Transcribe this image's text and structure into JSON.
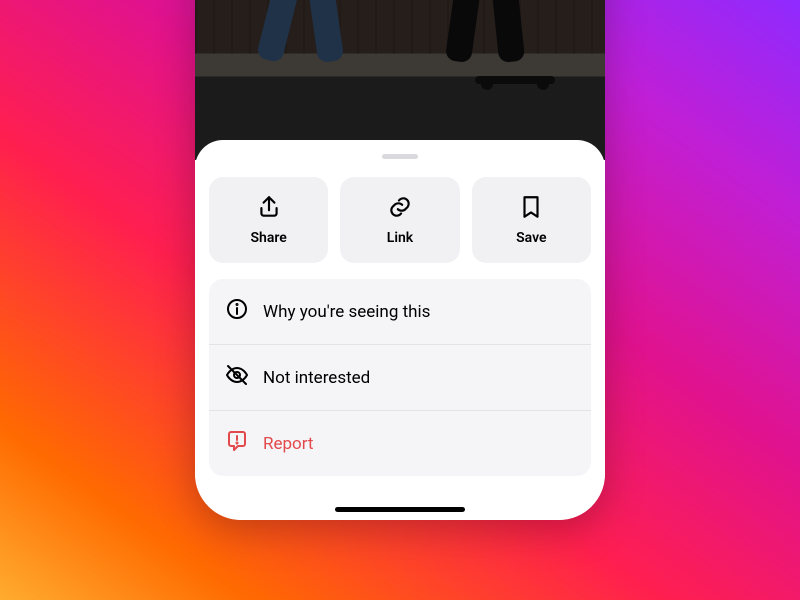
{
  "colors": {
    "sheet_bg": "#ffffff",
    "tile_bg": "#f1f1f3",
    "list_bg": "#f5f5f7",
    "divider": "#e3e3e6",
    "danger": "#e2494c",
    "gradient": [
      "#ffac2e",
      "#ff6a00",
      "#ff1f4f",
      "#e1128d",
      "#c01fd6",
      "#8f2aff"
    ]
  },
  "actions": {
    "share": {
      "icon": "share-icon",
      "label": "Share"
    },
    "link": {
      "icon": "link-icon",
      "label": "Link"
    },
    "save": {
      "icon": "bookmark-icon",
      "label": "Save"
    }
  },
  "menu": [
    {
      "id": "why",
      "icon": "info-icon",
      "label": "Why you're seeing this",
      "danger": false
    },
    {
      "id": "not-interested",
      "icon": "eye-off-icon",
      "label": "Not interested",
      "danger": false
    },
    {
      "id": "report",
      "icon": "report-icon",
      "label": "Report",
      "danger": true
    }
  ]
}
